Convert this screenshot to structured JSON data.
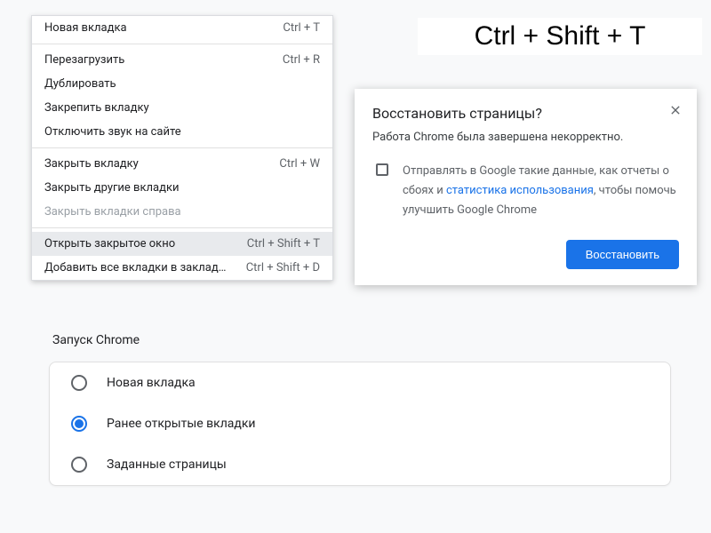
{
  "context_menu": {
    "items": [
      {
        "label": "Новая вкладка",
        "shortcut": "Ctrl + T",
        "type": "item"
      },
      {
        "type": "sep"
      },
      {
        "label": "Перезагрузить",
        "shortcut": "Ctrl + R",
        "type": "item"
      },
      {
        "label": "Дублировать",
        "shortcut": "",
        "type": "item"
      },
      {
        "label": "Закрепить вкладку",
        "shortcut": "",
        "type": "item"
      },
      {
        "label": "Отключить звук на сайте",
        "shortcut": "",
        "type": "item"
      },
      {
        "type": "sep"
      },
      {
        "label": "Закрыть вкладку",
        "shortcut": "Ctrl + W",
        "type": "item"
      },
      {
        "label": "Закрыть другие вкладки",
        "shortcut": "",
        "type": "item"
      },
      {
        "label": "Закрыть вкладки справа",
        "shortcut": "",
        "type": "item",
        "disabled": true
      },
      {
        "type": "sep"
      },
      {
        "label": "Открыть закрытое окно",
        "shortcut": "Ctrl + Shift + T",
        "type": "item",
        "highlighted": true
      },
      {
        "label": "Добавить все вкладки в закладки…",
        "shortcut": "Ctrl + Shift + D",
        "type": "item"
      }
    ]
  },
  "big_shortcut": "Ctrl + Shift + T",
  "restore_dialog": {
    "title": "Восстановить страницы?",
    "subtitle": "Работа Chrome была завершена некорректно.",
    "checkbox_text_1": "Отправлять в Google такие данные, как отчеты о сбоях и ",
    "checkbox_link": "статистика использования",
    "checkbox_text_2": ", чтобы помочь улучшить Google Chrome",
    "button": "Восстановить"
  },
  "startup": {
    "heading": "Запуск Chrome",
    "options": [
      {
        "label": "Новая вкладка",
        "selected": false
      },
      {
        "label": "Ранее открытые вкладки",
        "selected": true
      },
      {
        "label": "Заданные страницы",
        "selected": false
      }
    ]
  }
}
